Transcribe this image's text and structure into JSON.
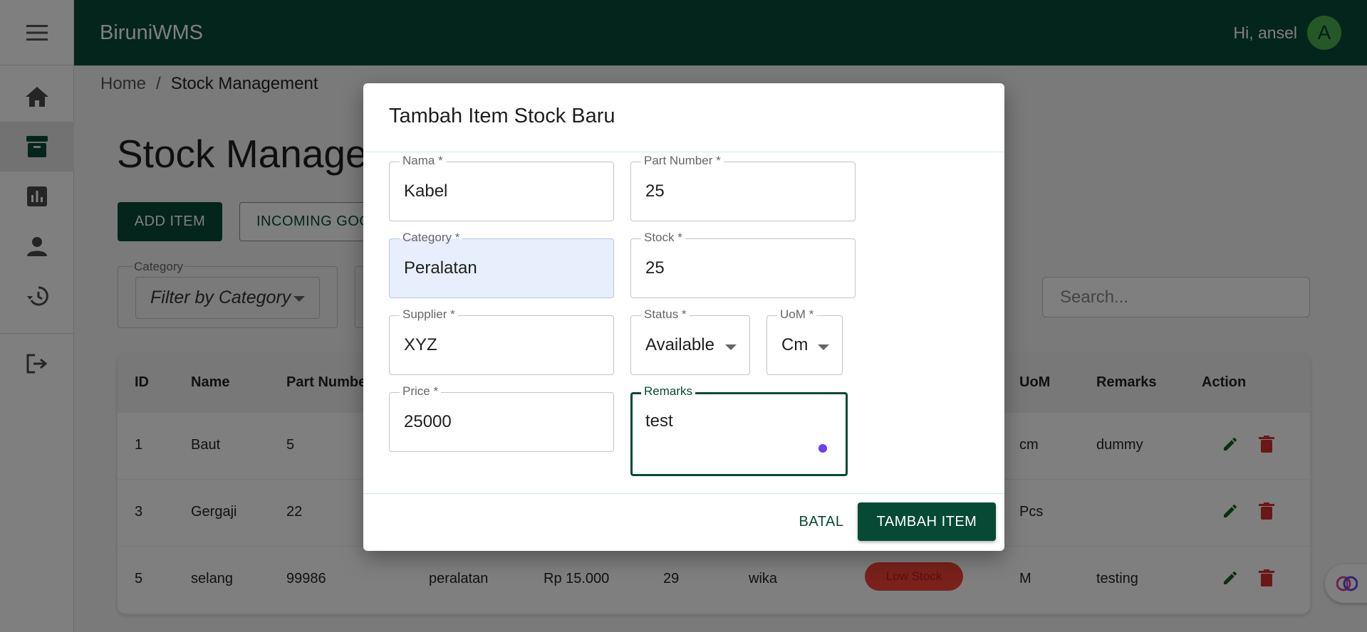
{
  "app": {
    "brand": "BiruniWMS",
    "greeting": "Hi, ansel",
    "avatar_initial": "A"
  },
  "sidebar": {
    "items": [
      "menu-icon",
      "home-icon",
      "inventory-box-icon",
      "reports-chart-icon",
      "user-icon",
      "history-icon",
      "logout-icon"
    ],
    "active": "inventory-box-icon"
  },
  "breadcrumb": {
    "home": "Home",
    "separator": "/",
    "current": "Stock Management"
  },
  "page": {
    "title": "Stock Management",
    "add_button": "ADD ITEM",
    "incoming_button": "INCOMING GOODS",
    "filter_legend": "Category",
    "filter_placeholder": "Filter by Category",
    "search_placeholder": "Search..."
  },
  "table": {
    "headers": {
      "id": "ID",
      "name": "Name",
      "part_number": "Part Number",
      "uom": "UoM",
      "remarks": "Remarks",
      "action": "Action"
    },
    "rows": [
      {
        "id": "1",
        "name": "Baut",
        "part_number": "5",
        "category": "",
        "price": "",
        "stock": "",
        "supplier": "",
        "status": "",
        "uom": "cm",
        "remarks": "dummy"
      },
      {
        "id": "3",
        "name": "Gergaji",
        "part_number": "22",
        "category": "",
        "price": "",
        "stock": "",
        "supplier": "",
        "status": "",
        "uom": "Pcs",
        "remarks": ""
      },
      {
        "id": "5",
        "name": "selang",
        "part_number": "99986",
        "category": "peralatan",
        "price": "Rp 15.000",
        "stock": "29",
        "supplier": "wika",
        "status": "Low Stock",
        "uom": "M",
        "remarks": "testing"
      }
    ]
  },
  "dialog": {
    "title": "Tambah Item Stock Baru",
    "fields": {
      "nama": {
        "label": "Nama *",
        "value": "Kabel"
      },
      "part_number": {
        "label": "Part Number *",
        "value": "25"
      },
      "category": {
        "label": "Category *",
        "value": "Peralatan"
      },
      "stock": {
        "label": "Stock *",
        "value": "25"
      },
      "supplier": {
        "label": "Supplier *",
        "value": "XYZ"
      },
      "status": {
        "label": "Status *",
        "value": "Available"
      },
      "uom": {
        "label": "UoM *",
        "value": "Cm"
      },
      "price": {
        "label": "Price *",
        "value": "25000"
      },
      "remarks": {
        "label": "Remarks",
        "value": "test"
      }
    },
    "cancel_button": "BATAL",
    "submit_button": "TAMBAH ITEM"
  },
  "colors": {
    "primary": "#064a36",
    "accent_green": "#4caf50",
    "danger": "#d32f2f",
    "focus_dot": "#6a3df5",
    "filled_field": "#e8effc"
  }
}
